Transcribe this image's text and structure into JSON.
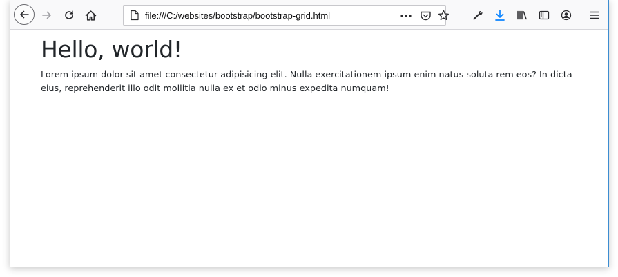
{
  "browser": {
    "url": "file:///C:/websites/bootstrap/bootstrap-grid.html",
    "accent": "#0a84ff",
    "nav_icons": [
      "back-arrow-icon",
      "forward-arrow-icon",
      "reload-icon",
      "home-icon"
    ],
    "url_icons": [
      "page-icon",
      "more-icon",
      "pocket-icon",
      "star-icon"
    ],
    "toolbar_icons": [
      "wrench-icon",
      "download-icon",
      "library-icon",
      "sidebar-icon",
      "account-icon",
      "menu-icon"
    ]
  },
  "page": {
    "heading": "Hello, world!",
    "paragraph": "Lorem ipsum dolor sit amet consectetur adipisicing elit. Nulla exercitationem ipsum enim natus soluta rem eos? In dicta eius, reprehenderit illo odit mollitia nulla ex et odio minus expedita numquam!"
  }
}
